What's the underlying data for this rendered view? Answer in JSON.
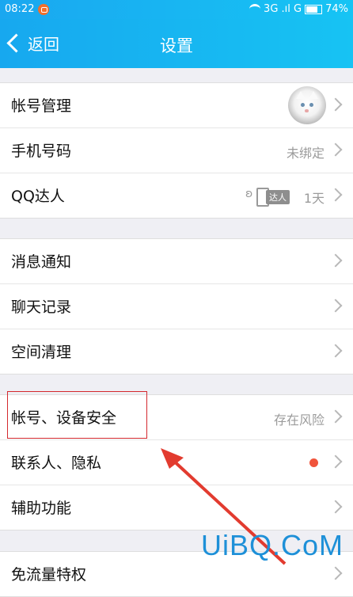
{
  "status_bar": {
    "time": "08:22",
    "network": "3G .ıl G",
    "battery": "74%"
  },
  "nav": {
    "back_label": "返回",
    "title": "设置"
  },
  "groups": [
    {
      "rows": [
        {
          "label": "帐号管理",
          "right": "avatar"
        },
        {
          "label": "手机号码",
          "right_text": "未绑定"
        },
        {
          "label": "QQ达人",
          "badge": "达人",
          "right_text": "1天"
        }
      ]
    },
    {
      "rows": [
        {
          "label": "消息通知"
        },
        {
          "label": "聊天记录"
        },
        {
          "label": "空间清理"
        }
      ]
    },
    {
      "rows": [
        {
          "label": "帐号、设备安全",
          "right_text": "存在风险"
        },
        {
          "label": "联系人、隐私",
          "indicator": "red-dot"
        },
        {
          "label": "辅助功能"
        }
      ]
    },
    {
      "rows": [
        {
          "label": "免流量特权"
        }
      ]
    }
  ],
  "watermark": "UiBQ.CoM",
  "colors": {
    "header": "#17b3f1",
    "highlight": "#d4282e",
    "red_dot": "#f0543b"
  }
}
